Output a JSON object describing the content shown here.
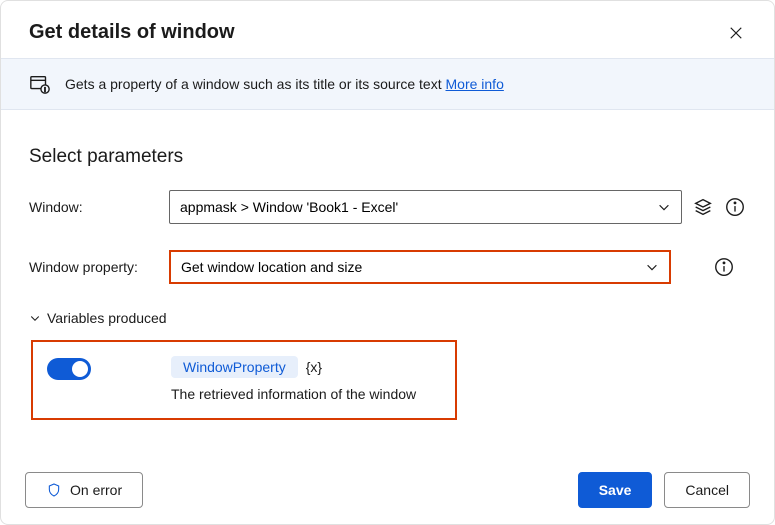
{
  "header": {
    "title": "Get details of window"
  },
  "banner": {
    "text": "Gets a property of a window such as its title or its source text ",
    "link": "More info"
  },
  "section_title": "Select parameters",
  "params": {
    "window_label": "Window:",
    "window_value": "appmask > Window 'Book1 - Excel'",
    "property_label": "Window property:",
    "property_value": "Get window location and size"
  },
  "variables": {
    "header": "Variables produced",
    "name": "WindowProperty",
    "type": "{x}",
    "desc": "The retrieved information of the window"
  },
  "footer": {
    "on_error": "On error",
    "save": "Save",
    "cancel": "Cancel"
  }
}
